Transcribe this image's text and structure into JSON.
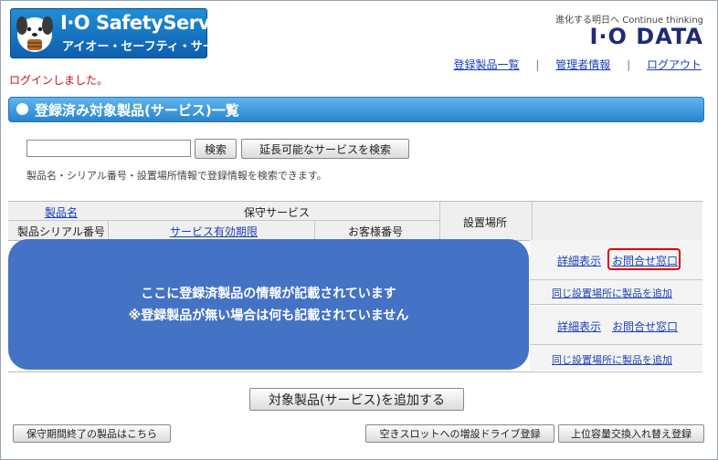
{
  "header": {
    "logo_title": "I·O SafetyService",
    "logo_subtitle": "アイオー・セーフティ・サービス",
    "tagline": "進化する明日へ Continue thinking",
    "brand": "I·O DATA"
  },
  "topnav": {
    "items": [
      "登録製品一覧",
      "管理者情報",
      "ログアウト"
    ]
  },
  "login_message": "ログインしました。",
  "title": "登録済み対象製品(サービス)一覧",
  "search": {
    "value": "",
    "button_search": "検索",
    "button_search_extendable": "延長可能なサービスを検索",
    "hint": "製品名・シリアル番号・設置場所情報で登録情報を検索できます。"
  },
  "table": {
    "col_product_name": "製品名",
    "col_maintenance_service": "保守サービス",
    "col_location": "設置場所",
    "col_serial": "製品シリアル番号",
    "col_service_expiry": "サービス有効期限",
    "col_customer_no": "お客様番号",
    "rows": [
      {
        "detail": "詳細表示",
        "inquiry": "お問合せ窓口",
        "add_same_location": "同じ設置場所に製品を追加"
      },
      {
        "detail": "詳細表示",
        "inquiry": "お問合せ窓口",
        "add_same_location": "同じ設置場所に製品を追加"
      }
    ]
  },
  "overlay": {
    "line1": "ここに登録済製品の情報が記載されています",
    "line2": "※登録製品が無い場合は何も記載されていません"
  },
  "buttons": {
    "add_product": "対象製品(サービス)を追加する",
    "expired_products": "保守期間終了の製品はこちら",
    "expansion_drive": "空きスロットへの増設ドライブ登録",
    "upgrade_replace": "上位容量交換入れ替え登録"
  },
  "colors": {
    "accent_blue": "#2a84cd",
    "overlay_blue": "#4472c4",
    "highlight_red": "#e00000",
    "login_red": "#cc1111"
  }
}
